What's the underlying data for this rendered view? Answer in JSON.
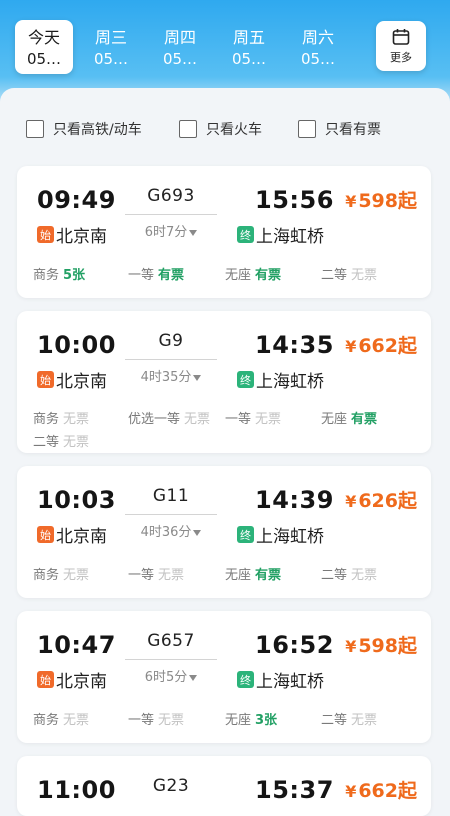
{
  "dates": [
    {
      "dow": "今天",
      "date": "05…",
      "active": true
    },
    {
      "dow": "周三",
      "date": "05…",
      "active": false
    },
    {
      "dow": "周四",
      "date": "05…",
      "active": false
    },
    {
      "dow": "周五",
      "date": "05…",
      "active": false
    },
    {
      "dow": "周六",
      "date": "05…",
      "active": false
    }
  ],
  "more_label": "更多",
  "filters": [
    "只看高铁/动车",
    "只看火车",
    "只看有票"
  ],
  "colors": {
    "accent": "#2fa9ef",
    "price": "#ef6a1c",
    "available": "#22a064",
    "unavailable": "#c2c2c2"
  },
  "trains": [
    {
      "dep": "09:49",
      "code": "G693",
      "arr": "15:56",
      "duration": "6时7分",
      "from": "北京南",
      "to": "上海虹桥",
      "price": "598起",
      "seats": [
        {
          "type": "商务",
          "status": "5张",
          "avail": true
        },
        {
          "type": "一等",
          "status": "有票",
          "avail": true
        },
        {
          "type": "无座",
          "status": "有票",
          "avail": true
        },
        {
          "type": "二等",
          "status": "无票",
          "avail": false
        }
      ]
    },
    {
      "dep": "10:00",
      "code": "G9",
      "arr": "14:35",
      "duration": "4时35分",
      "from": "北京南",
      "to": "上海虹桥",
      "price": "662起",
      "seats": [
        {
          "type": "商务",
          "status": "无票",
          "avail": false
        },
        {
          "type": "优选一等",
          "status": "无票",
          "avail": false
        },
        {
          "type": "一等",
          "status": "无票",
          "avail": false
        },
        {
          "type": "无座",
          "status": "有票",
          "avail": true
        },
        {
          "type": "二等",
          "status": "无票",
          "avail": false
        }
      ]
    },
    {
      "dep": "10:03",
      "code": "G11",
      "arr": "14:39",
      "duration": "4时36分",
      "from": "北京南",
      "to": "上海虹桥",
      "price": "626起",
      "seats": [
        {
          "type": "商务",
          "status": "无票",
          "avail": false
        },
        {
          "type": "一等",
          "status": "无票",
          "avail": false
        },
        {
          "type": "无座",
          "status": "有票",
          "avail": true
        },
        {
          "type": "二等",
          "status": "无票",
          "avail": false
        }
      ]
    },
    {
      "dep": "10:47",
      "code": "G657",
      "arr": "16:52",
      "duration": "6时5分",
      "from": "北京南",
      "to": "上海虹桥",
      "price": "598起",
      "seats": [
        {
          "type": "商务",
          "status": "无票",
          "avail": false
        },
        {
          "type": "一等",
          "status": "无票",
          "avail": false
        },
        {
          "type": "无座",
          "status": "3张",
          "avail": true
        },
        {
          "type": "二等",
          "status": "无票",
          "avail": false
        }
      ]
    },
    {
      "dep": "11:00",
      "code": "G23",
      "arr": "15:37",
      "price": "662起"
    }
  ]
}
